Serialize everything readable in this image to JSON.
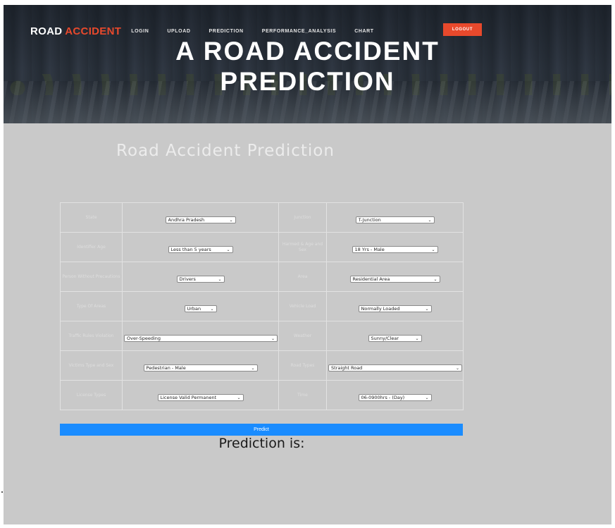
{
  "header": {
    "brand_main": "ROAD",
    "brand_accent": "ACCIDENT",
    "nav": [
      "LOGIN",
      "UPLOAD",
      "PREDICTION",
      "PERFORMANCE_ANALYSIS",
      "CHART"
    ],
    "logout_label": "LOGOUT",
    "hero_title_line1": "A ROAD ACCIDENT",
    "hero_title_line2": "PREDICTION"
  },
  "main": {
    "heading": "Road Accident Prediction",
    "rows": [
      {
        "left_label": "State",
        "left_value": "Andhra Pradesh",
        "right_label": "Junction",
        "right_value": "T-Junction"
      },
      {
        "left_label": "Identifier Age",
        "left_value": "Less than 5 years",
        "right_label": "Harmed & Age and Sex",
        "right_value": "18 Yrs - Male"
      },
      {
        "left_label": "Person Without Precautions",
        "left_value": "Drivers",
        "right_label": "Area",
        "right_value": "Residential Area"
      },
      {
        "left_label": "Type Of Areas",
        "left_value": "Urban",
        "right_label": "Vehicle Load",
        "right_value": "Normally Loaded"
      },
      {
        "left_label": "Traffic Rules Violation",
        "left_value": "Over-Speeding",
        "right_label": "Weather",
        "right_value": "Sunny/Clear"
      },
      {
        "left_label": "Victims Type and Sex",
        "left_value": "Pedestrian - Male",
        "right_label": "Road Types",
        "right_value": "Straight Road"
      },
      {
        "left_label": "License Types",
        "left_value": "License Valid Permanent",
        "right_label": "Time",
        "right_value": "06-0900hrs - (Day)"
      }
    ],
    "predict_label": "Predict",
    "prediction_text": "Prediction is:"
  },
  "colors": {
    "accent": "#e8492c",
    "button": "#1a8cff",
    "background": "#c9c9c9"
  }
}
